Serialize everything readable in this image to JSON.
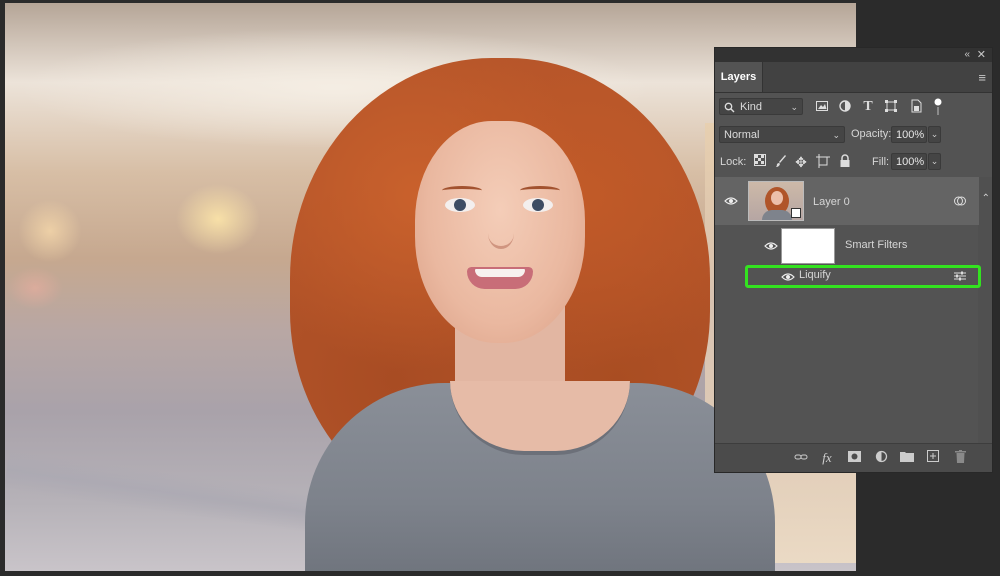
{
  "panel": {
    "collapse_glyph": "«",
    "close_glyph": "✕",
    "tab_label": "Layers",
    "menu_glyph": "≡"
  },
  "filter": {
    "kind_label": "Kind",
    "chevron": "⌄",
    "icons": [
      "image-filter-icon",
      "adjustment-filter-icon",
      "type-filter-icon",
      "shape-filter-icon",
      "smart-object-filter-icon",
      "filter-toggle-icon"
    ]
  },
  "blend": {
    "mode": "Normal",
    "opacity_label": "Opacity:",
    "opacity_value": "100%",
    "fill_label": "Fill:",
    "fill_value": "100%"
  },
  "lock": {
    "label": "Lock:",
    "icons": [
      "lock-transparent-icon",
      "lock-paint-icon",
      "lock-position-icon",
      "lock-artboard-icon",
      "lock-all-icon"
    ]
  },
  "layers": [
    {
      "name": "Layer 0",
      "visible": true,
      "type": "smart-object"
    },
    {
      "name": "Smart Filters",
      "visible": true,
      "type": "smart-filters"
    },
    {
      "name": "Liquify",
      "visible": true,
      "type": "filter",
      "highlighted": true
    }
  ],
  "footer_icons": [
    "link-layers-icon",
    "fx-icon",
    "add-mask-icon",
    "adjustment-layer-icon",
    "new-group-icon",
    "new-layer-icon",
    "delete-layer-icon"
  ],
  "footer": {
    "fx_label": "fx"
  },
  "colors": {
    "highlight": "#33e320",
    "panel_bg": "#535353",
    "selected_row": "#646464"
  }
}
